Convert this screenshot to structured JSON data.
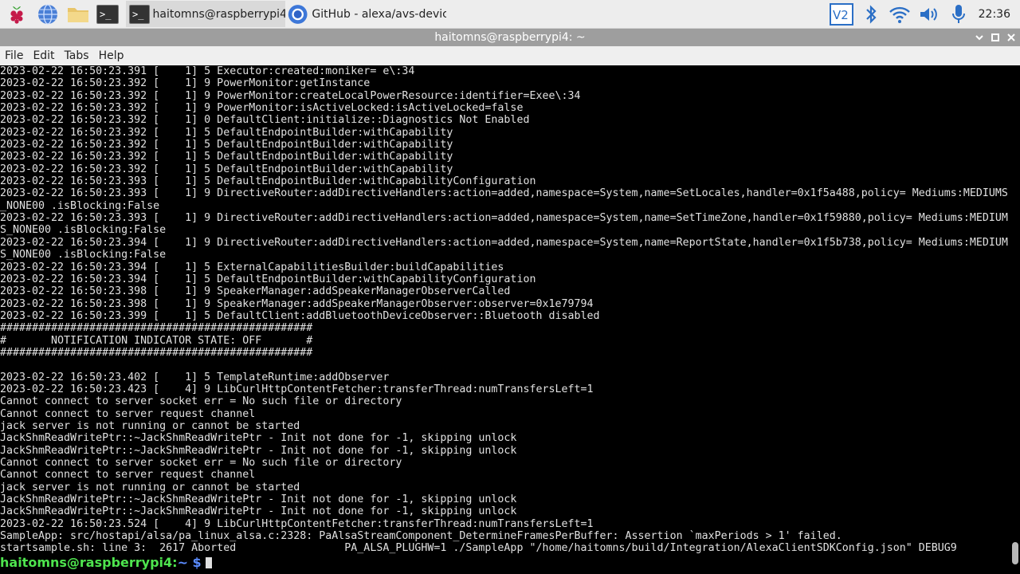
{
  "taskbar": {
    "tasks": [
      {
        "label": "haitomns@raspberrypi4:...",
        "active": true
      },
      {
        "label": "GitHub - alexa/avs-devic...",
        "active": false
      }
    ],
    "clock": "22:36",
    "icons": [
      "raspberry-icon",
      "browser-globe-icon",
      "file-manager-icon",
      "terminal-launcher-icon",
      "vnc-icon",
      "bluetooth-icon",
      "wifi-icon",
      "volume-icon",
      "microphone-icon"
    ]
  },
  "window": {
    "title": "haitomns@raspberrypi4: ~"
  },
  "menu": [
    "File",
    "Edit",
    "Tabs",
    "Help"
  ],
  "terminal": {
    "lines": [
      "2023-02-22 16:50:23.391 [    1] 5 Executor:created:moniker= e\\:34",
      "2023-02-22 16:50:23.392 [    1] 9 PowerMonitor:getInstance",
      "2023-02-22 16:50:23.392 [    1] 9 PowerMonitor:createLocalPowerResource:identifier=Exee\\:34",
      "2023-02-22 16:50:23.392 [    1] 9 PowerMonitor:isActiveLocked:isActiveLocked=false",
      "2023-02-22 16:50:23.392 [    1] 0 DefaultClient:initialize::Diagnostics Not Enabled",
      "2023-02-22 16:50:23.392 [    1] 5 DefaultEndpointBuilder:withCapability",
      "2023-02-22 16:50:23.392 [    1] 5 DefaultEndpointBuilder:withCapability",
      "2023-02-22 16:50:23.392 [    1] 5 DefaultEndpointBuilder:withCapability",
      "2023-02-22 16:50:23.392 [    1] 5 DefaultEndpointBuilder:withCapability",
      "2023-02-22 16:50:23.393 [    1] 5 DefaultEndpointBuilder:withCapabilityConfiguration",
      "2023-02-22 16:50:23.393 [    1] 9 DirectiveRouter:addDirectiveHandlers:action=added,namespace=System,name=SetLocales,handler=0x1f5a488,policy= Mediums:MEDIUMS",
      "_NONE00 .isBlocking:False",
      "2023-02-22 16:50:23.393 [    1] 9 DirectiveRouter:addDirectiveHandlers:action=added,namespace=System,name=SetTimeZone,handler=0x1f59880,policy= Mediums:MEDIUM",
      "S_NONE00 .isBlocking:False",
      "2023-02-22 16:50:23.394 [    1] 9 DirectiveRouter:addDirectiveHandlers:action=added,namespace=System,name=ReportState,handler=0x1f5b738,policy= Mediums:MEDIUM",
      "S_NONE00 .isBlocking:False",
      "2023-02-22 16:50:23.394 [    1] 5 ExternalCapabilitiesBuilder:buildCapabilities",
      "2023-02-22 16:50:23.394 [    1] 5 DefaultEndpointBuilder:withCapabilityConfiguration",
      "2023-02-22 16:50:23.398 [    1] 9 SpeakerManager:addSpeakerManagerObserverCalled",
      "2023-02-22 16:50:23.398 [    1] 9 SpeakerManager:addSpeakerManagerObserver:observer=0x1e79794",
      "2023-02-22 16:50:23.399 [    1] 5 DefaultClient:addBluetoothDeviceObserver::Bluetooth disabled",
      "#################################################",
      "#       NOTIFICATION INDICATOR STATE: OFF       #",
      "#################################################",
      "",
      "2023-02-22 16:50:23.402 [    1] 5 TemplateRuntime:addObserver",
      "2023-02-22 16:50:23.423 [    4] 9 LibCurlHttpContentFetcher:transferThread:numTransfersLeft=1",
      "Cannot connect to server socket err = No such file or directory",
      "Cannot connect to server request channel",
      "jack server is not running or cannot be started",
      "JackShmReadWritePtr::~JackShmReadWritePtr - Init not done for -1, skipping unlock",
      "JackShmReadWritePtr::~JackShmReadWritePtr - Init not done for -1, skipping unlock",
      "Cannot connect to server socket err = No such file or directory",
      "Cannot connect to server request channel",
      "jack server is not running or cannot be started",
      "JackShmReadWritePtr::~JackShmReadWritePtr - Init not done for -1, skipping unlock",
      "JackShmReadWritePtr::~JackShmReadWritePtr - Init not done for -1, skipping unlock",
      "2023-02-22 16:50:23.524 [    4] 9 LibCurlHttpContentFetcher:transferThread:numTransfersLeft=1",
      "SampleApp: src/hostapi/alsa/pa_linux_alsa.c:2328: PaAlsaStreamComponent_DetermineFramesPerBuffer: Assertion `maxPeriods > 1' failed.",
      "startsample.sh: line 3:  2617 Aborted                 PA_ALSA_PLUGHW=1 ./SampleApp \"/home/haitomns/build/Integration/AlexaClientSDKConfig.json\" DEBUG9"
    ],
    "prompt_user": "haitomns@raspberrypi4",
    "prompt_sep": ":",
    "prompt_path": "~ $",
    "scroll_position": 0.98
  }
}
